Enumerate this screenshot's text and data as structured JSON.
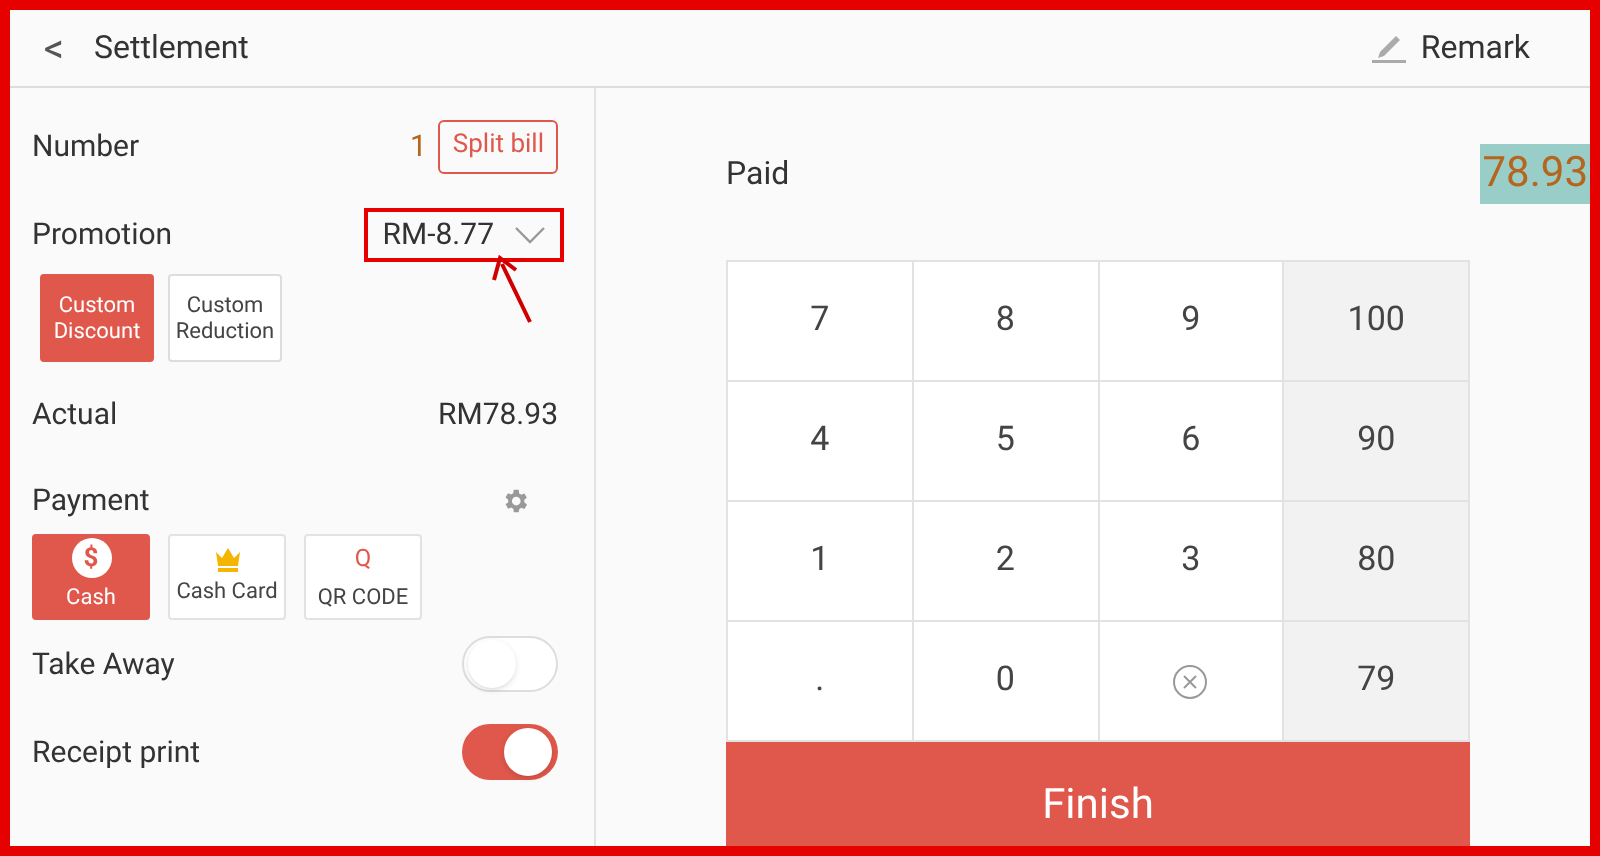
{
  "header": {
    "back": "<",
    "title": "Settlement",
    "remark": "Remark"
  },
  "left": {
    "number": {
      "label": "Number",
      "value": "1",
      "button": "Split bill"
    },
    "promotion": {
      "label": "Promotion",
      "value": "RM-8.77",
      "options": [
        {
          "label": "Custom Discount",
          "selected": true
        },
        {
          "label": "Custom Reduction",
          "selected": false
        }
      ]
    },
    "actual": {
      "label": "Actual",
      "value": "RM78.93"
    },
    "payment": {
      "label": "Payment",
      "methods": [
        {
          "kind": "cash",
          "label": "Cash",
          "glyph": "$",
          "selected": true
        },
        {
          "kind": "card",
          "label": "Cash Card",
          "selected": false
        },
        {
          "kind": "qr",
          "label": "QR CODE",
          "glyph": "Q",
          "selected": false
        }
      ]
    },
    "toggles": [
      {
        "label": "Take Away",
        "on": false
      },
      {
        "label": "Receipt print",
        "on": true
      }
    ]
  },
  "right": {
    "paid_label": "Paid",
    "paid_value": "78.93",
    "keys": [
      {
        "kind": "digit",
        "label": "7"
      },
      {
        "kind": "digit",
        "label": "8"
      },
      {
        "kind": "digit",
        "label": "9"
      },
      {
        "kind": "quick",
        "label": "100"
      },
      {
        "kind": "digit",
        "label": "4"
      },
      {
        "kind": "digit",
        "label": "5"
      },
      {
        "kind": "digit",
        "label": "6"
      },
      {
        "kind": "quick",
        "label": "90"
      },
      {
        "kind": "digit",
        "label": "1"
      },
      {
        "kind": "digit",
        "label": "2"
      },
      {
        "kind": "digit",
        "label": "3"
      },
      {
        "kind": "quick",
        "label": "80"
      },
      {
        "kind": "digit",
        "label": "."
      },
      {
        "kind": "digit",
        "label": "0"
      },
      {
        "kind": "delete"
      },
      {
        "kind": "quick",
        "label": "79"
      }
    ],
    "finish": "Finish"
  }
}
